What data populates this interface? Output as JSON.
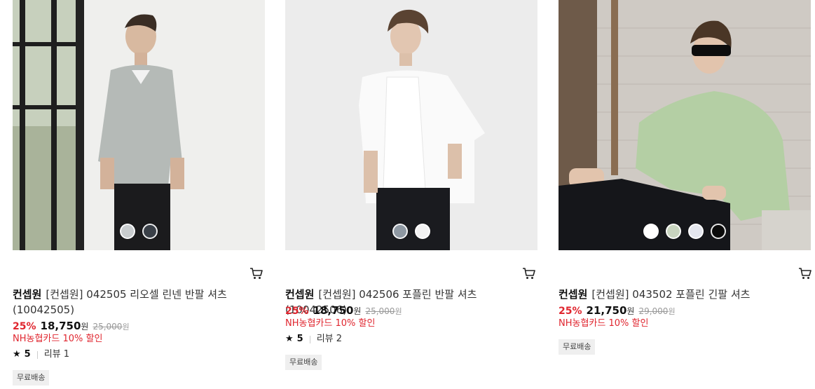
{
  "products": [
    {
      "brand": "컨셉원",
      "title": "[컨셉원] 042505 리오셀 린넨 반팔 셔츠 (10042505)",
      "discount": "25%",
      "price": "18,750",
      "price_unit": "원",
      "original_price": "25,000",
      "original_unit": "원",
      "card_promo": "NH농협카드 10% 할인",
      "rating": "5",
      "review_label": "리뷰 1",
      "badge": "무료배송",
      "swatch_colors": [
        "#c9cdcf",
        "#3a4048"
      ]
    },
    {
      "brand": "컨셉원",
      "title": "[컨셉원] 042506 포플린 반팔 셔츠 (10042506)",
      "discount": "25%",
      "price": "18,750",
      "price_unit": "원",
      "original_price": "25,000",
      "original_unit": "원",
      "card_promo": "NH농협카드 10% 할인",
      "rating": "5",
      "review_label": "리뷰 2",
      "badge": "무료배송",
      "swatch_colors": [
        "#8e98a2",
        "#f2f2f2"
      ]
    },
    {
      "brand": "컨셉원",
      "title": "[컨셉원] 043502 포플린 긴팔 셔츠",
      "discount": "25%",
      "price": "21,750",
      "price_unit": "원",
      "original_price": "29,000",
      "original_unit": "원",
      "card_promo": "NH농협카드 10% 할인",
      "badge": "무료배송",
      "swatch_colors": [
        "#ffffff",
        "#c8d4bf",
        "#e4e6ee",
        "#0a0a0a"
      ]
    }
  ],
  "icons": {
    "cart": "cart-icon",
    "star": "star-icon"
  }
}
